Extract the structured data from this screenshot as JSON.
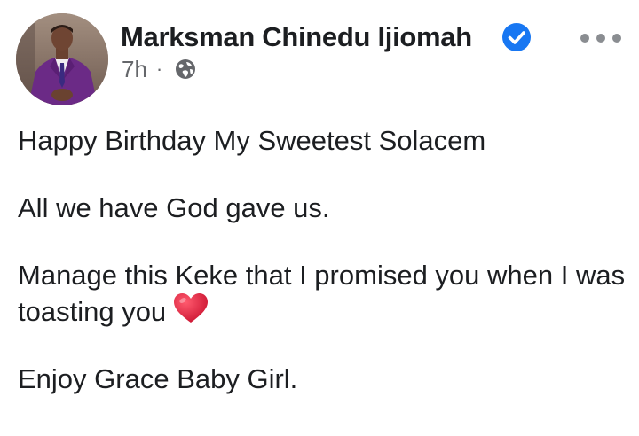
{
  "post": {
    "author": {
      "name": "Marksman Chinedu Ijiomah",
      "verified": true,
      "verified_icon": "verified-check-icon",
      "avatar_icon": "profile-photo"
    },
    "time": "7h",
    "separator": "·",
    "privacy_icon": "globe-icon",
    "more_icon": "more-options-icon",
    "paragraphs": {
      "p1": "Happy Birthday My Sweetest Solacem",
      "p2": "All we have God gave us.",
      "p3": "Manage this Keke that I promised you when I was toasting you",
      "p4": "Enjoy Grace Baby Girl."
    },
    "emoji_icon": "red-heart-icon"
  },
  "colors": {
    "text_primary": "#1c1e21",
    "text_secondary": "#65676b",
    "verified_blue": "#1877f2",
    "heart_red": "#e0203a"
  }
}
